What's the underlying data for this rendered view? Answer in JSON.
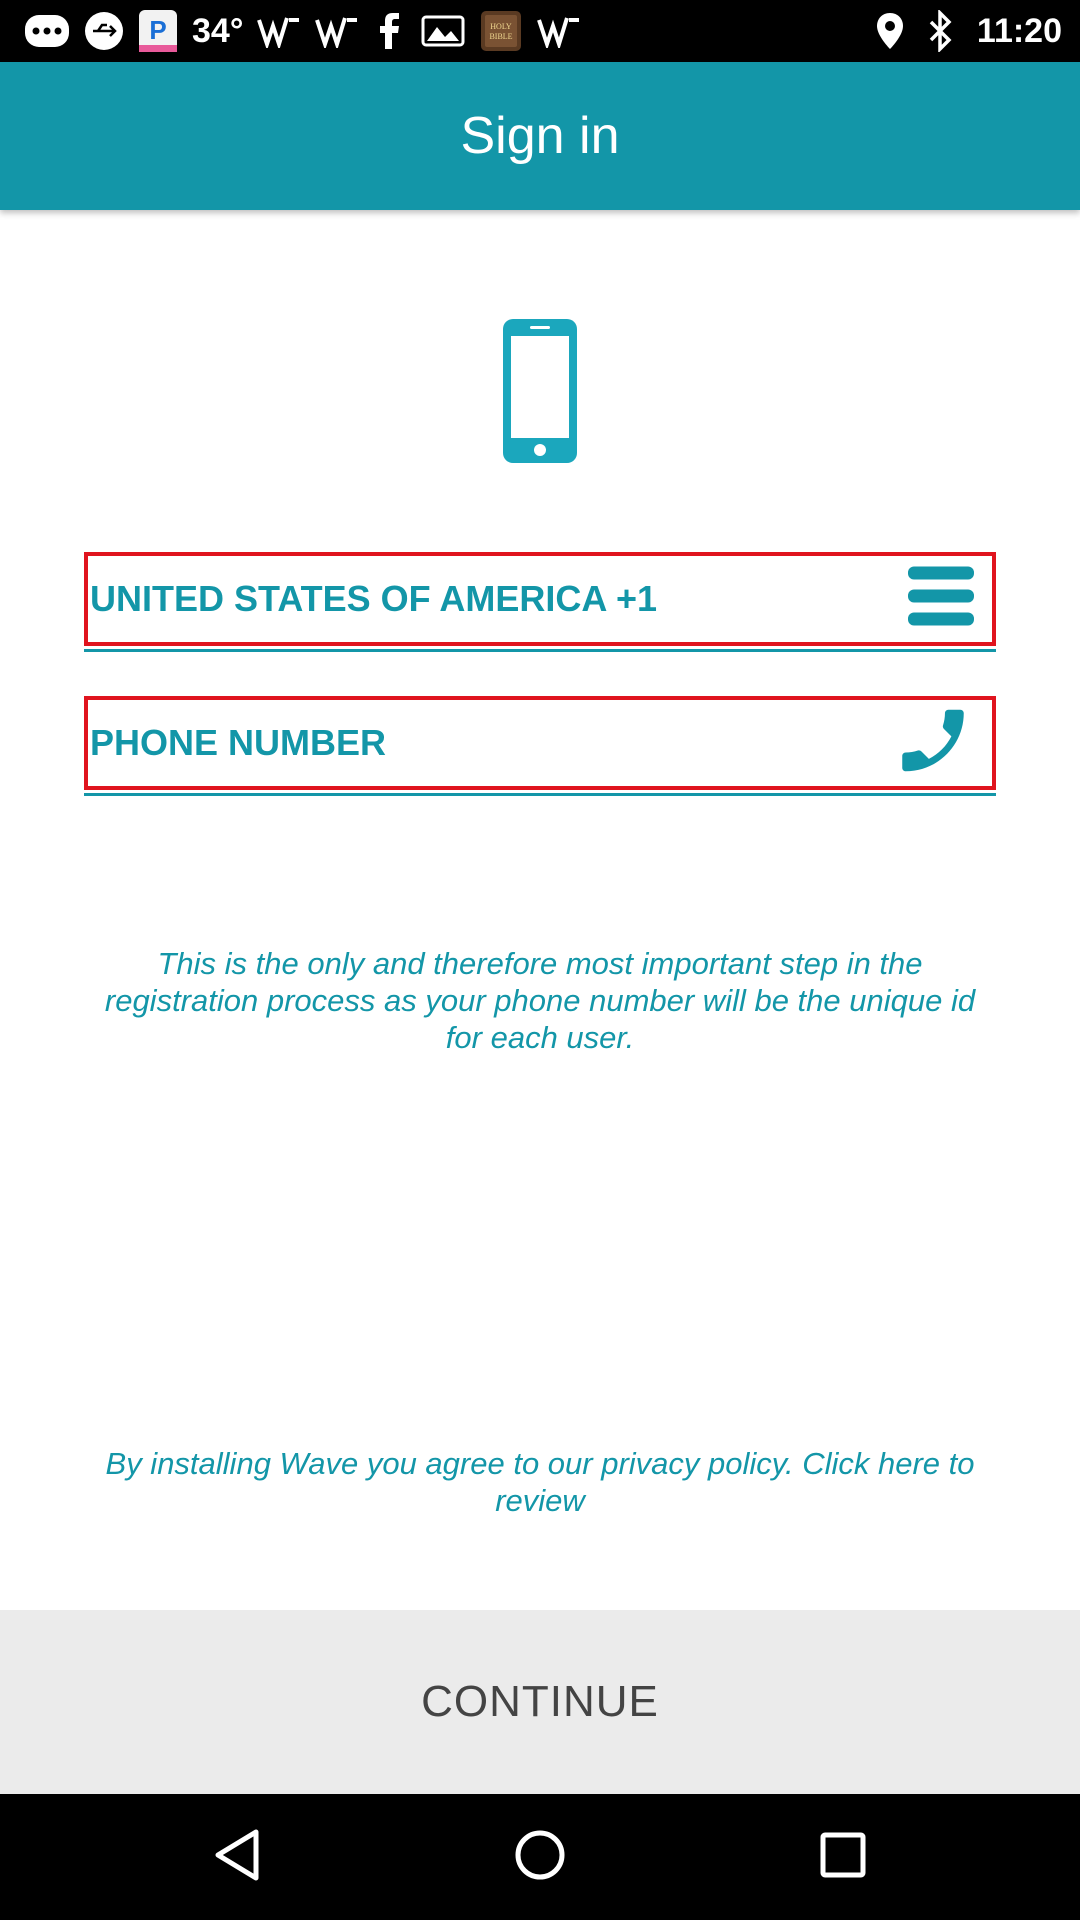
{
  "status_bar": {
    "temperature": "34°",
    "time": "11:20",
    "left_icons": [
      "more-dots-icon",
      "usb-icon",
      "app-p-icon",
      "temperature-text",
      "wave-signal-icon",
      "wave-signal-icon",
      "facebook-icon",
      "photo-icon",
      "holy-bible-app-icon",
      "wave-signal-icon"
    ],
    "right_icons": [
      "location-icon",
      "bluetooth-icon",
      "time-text"
    ]
  },
  "app_bar": {
    "title": "Sign in"
  },
  "country_field": {
    "value": "UNITED STATES OF AMERICA +1",
    "icon": "menu-icon"
  },
  "phone_field": {
    "placeholder": "PHONE NUMBER",
    "icon": "phone-icon"
  },
  "info": {
    "text": "This is the only and therefore most important step in the registration process as your phone number will be the unique id for each user."
  },
  "privacy": {
    "text": "By installing Wave you agree to our privacy policy. Click here to review"
  },
  "continue": {
    "label": "CONTINUE"
  },
  "colors": {
    "accent": "#1396a8",
    "highlight_border": "#e0141e",
    "button_bg": "#ebebeb"
  }
}
